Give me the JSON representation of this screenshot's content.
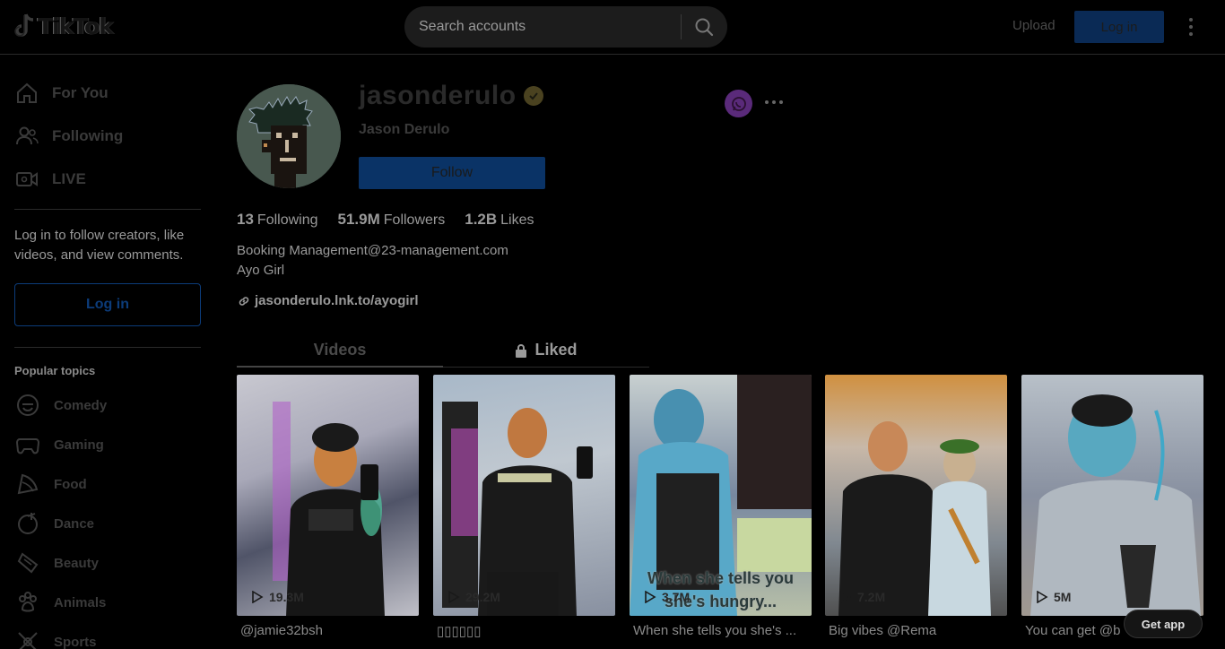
{
  "header": {
    "logo_text": "TikTok",
    "search_placeholder": "Search accounts",
    "upload_label": "Upload",
    "login_label": "Log in"
  },
  "sidebar": {
    "nav": [
      {
        "label": "For You",
        "icon": "home-icon"
      },
      {
        "label": "Following",
        "icon": "people-icon"
      },
      {
        "label": "LIVE",
        "icon": "live-icon"
      }
    ],
    "login_prompt": "Log in to follow creators, like videos, and view comments.",
    "login_button": "Log in",
    "popular_title": "Popular topics",
    "topics": [
      {
        "label": "Comedy",
        "icon": "comedy-icon"
      },
      {
        "label": "Gaming",
        "icon": "gamepad-icon"
      },
      {
        "label": "Food",
        "icon": "food-icon"
      },
      {
        "label": "Dance",
        "icon": "dance-icon"
      },
      {
        "label": "Beauty",
        "icon": "beauty-icon"
      },
      {
        "label": "Animals",
        "icon": "paw-icon"
      },
      {
        "label": "Sports",
        "icon": "sports-icon"
      }
    ]
  },
  "profile": {
    "username": "jasonderulo",
    "nickname": "Jason Derulo",
    "follow_label": "Follow",
    "stats": [
      {
        "value": "13",
        "label": "Following"
      },
      {
        "value": "51.9M",
        "label": "Followers"
      },
      {
        "value": "1.2B",
        "label": "Likes"
      }
    ],
    "bio_lines": [
      "Booking Management@23-management.com",
      "Ayo Girl"
    ],
    "link": "jasonderulo.lnk.to/ayogirl"
  },
  "tabs": [
    {
      "label": "Videos",
      "active": true
    },
    {
      "label": "Liked",
      "locked": true
    }
  ],
  "videos": [
    {
      "views": "19.3M",
      "caption": "@jamie32bsh"
    },
    {
      "views": "29.2M",
      "caption": "▯▯▯▯▯▯"
    },
    {
      "views": "3.7M",
      "caption": "When she tells you she's ...",
      "overlay": [
        "When she tells you",
        "she's hungry..."
      ]
    },
    {
      "views": "7.2M",
      "caption": "Big vibes @Rema"
    },
    {
      "views": "5M",
      "caption": "You can get @b"
    }
  ],
  "get_app_label": "Get app",
  "colors": {
    "accent_blue": "#0a3366",
    "background": "#000000",
    "verified": "#4a4220"
  }
}
